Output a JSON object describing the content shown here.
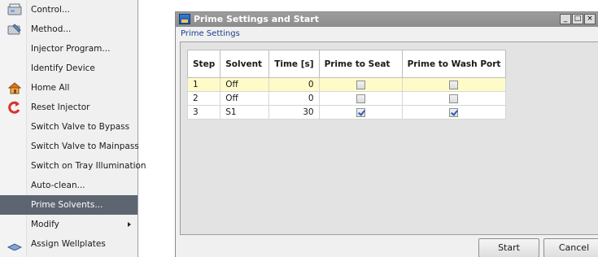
{
  "menu": {
    "items": [
      {
        "label": "Control...",
        "icon": "control-icon"
      },
      {
        "label": "Method...",
        "icon": "method-icon"
      },
      {
        "label": "Injector Program...",
        "icon": ""
      },
      {
        "label": "Identify Device",
        "icon": ""
      },
      {
        "label": "Home All",
        "icon": "home-icon"
      },
      {
        "label": "Reset Injector",
        "icon": "reset-icon"
      },
      {
        "label": "Switch Valve to Bypass",
        "icon": ""
      },
      {
        "label": "Switch Valve to Mainpass",
        "icon": ""
      },
      {
        "label": "Switch on Tray Illumination",
        "icon": ""
      },
      {
        "label": "Auto-clean...",
        "icon": ""
      },
      {
        "label": "Prime Solvents...",
        "icon": "",
        "selected": true
      },
      {
        "label": "Modify",
        "icon": "",
        "submenu": true
      },
      {
        "label": "Assign Wellplates",
        "icon": "wellplate-icon"
      }
    ]
  },
  "dialog": {
    "title": "Prime Settings and Start",
    "subtitle": "Prime Settings",
    "window_buttons": {
      "minimize": "_",
      "maximize": "□",
      "close": "×"
    },
    "table": {
      "headers": [
        "Step",
        "Solvent",
        "Time [s]",
        "Prime to Seat",
        "Prime to Wash Port"
      ],
      "rows": [
        {
          "step": "1",
          "solvent": "Off",
          "time": "0",
          "seat": false,
          "wash": false,
          "highlighted": true
        },
        {
          "step": "2",
          "solvent": "Off",
          "time": "0",
          "seat": false,
          "wash": false,
          "highlighted": false
        },
        {
          "step": "3",
          "solvent": "S1",
          "time": "30",
          "seat": true,
          "wash": true,
          "highlighted": false
        }
      ]
    },
    "buttons": {
      "start": "Start",
      "cancel": "Cancel"
    }
  },
  "colors": {
    "menu_selected": "#5d6570",
    "row_highlight": "#fffbc8",
    "titlebar": "#9c9c9c",
    "subtitle_text": "#1a3e8c"
  }
}
